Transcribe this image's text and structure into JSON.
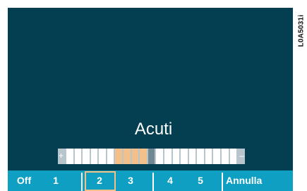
{
  "screen": {
    "title": "Acuti",
    "side_code": "L0A5031i"
  },
  "level": {
    "plus_sign": "+",
    "minus_sign": "–",
    "total_cells": 21,
    "active_from": 7,
    "active_to": 10,
    "separator_after": 11
  },
  "menu": {
    "items": [
      {
        "label": "Off"
      },
      {
        "label": "1"
      },
      {
        "label": "2"
      },
      {
        "label": "3"
      },
      {
        "label": "4"
      },
      {
        "label": "5"
      },
      {
        "label": "Annulla"
      }
    ],
    "selected_label": "2"
  },
  "colors": {
    "background": "#033f50",
    "menu": "#0f9fc2",
    "highlight": "#f4c08a"
  }
}
